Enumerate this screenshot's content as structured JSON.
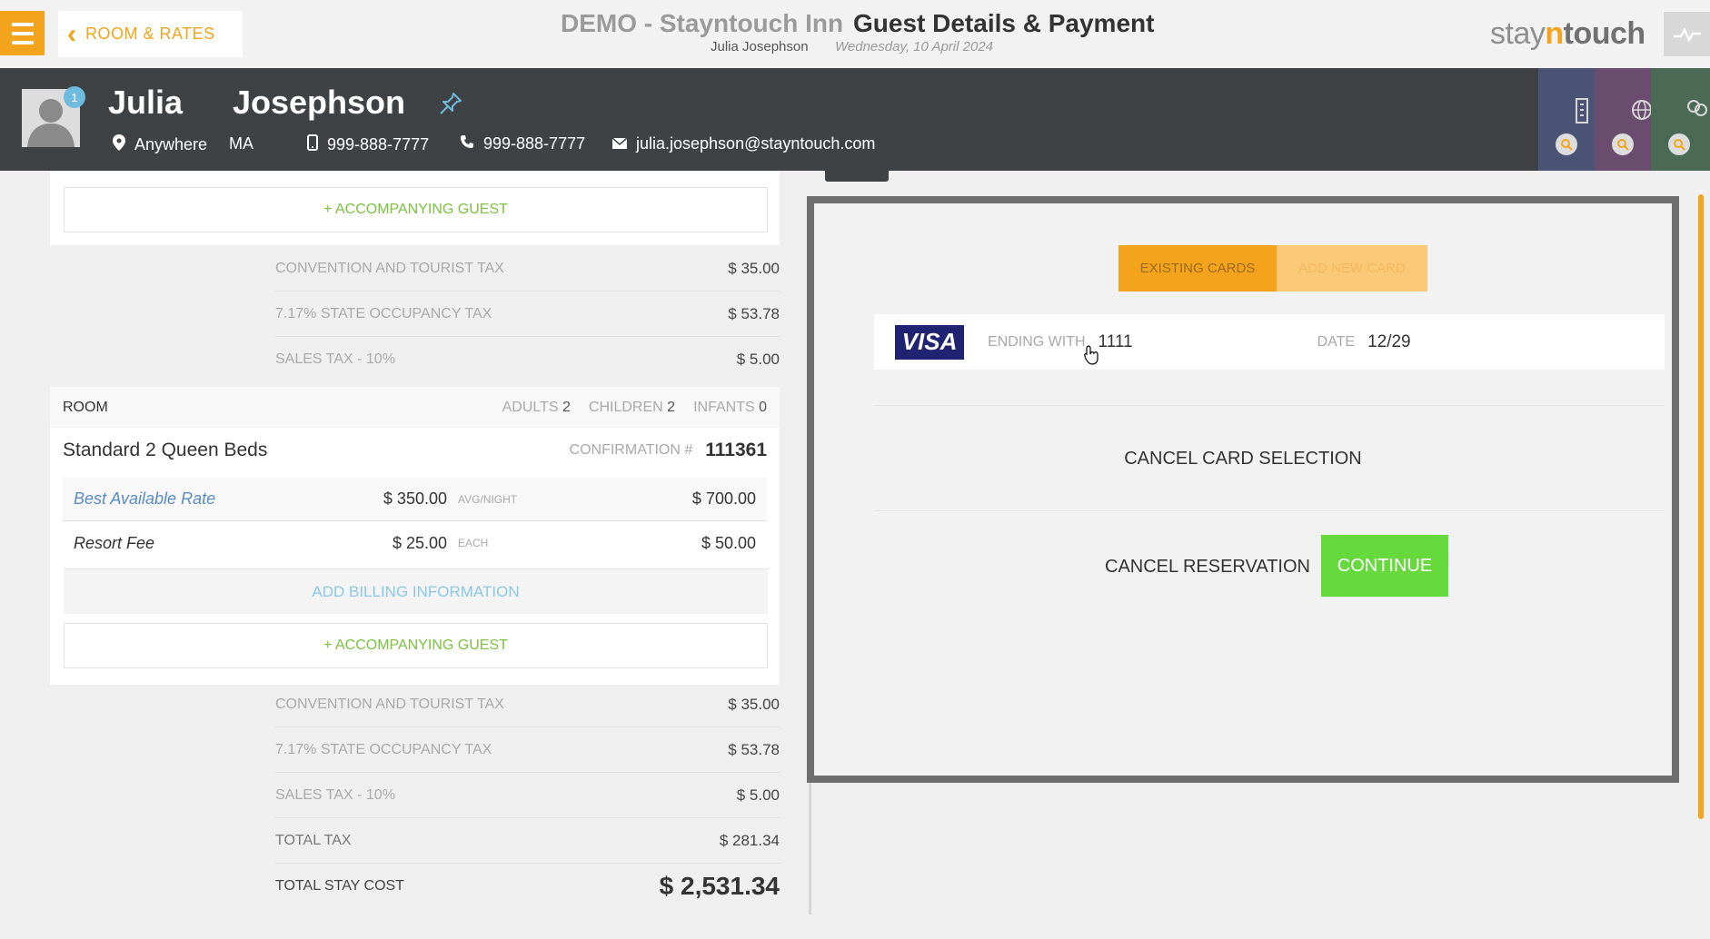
{
  "header": {
    "back_label": "ROOM & RATES",
    "hotel_title": "DEMO - Stayntouch Inn",
    "page_title": "Guest Details & Payment",
    "guest_name": "Julia Josephson",
    "date": "Wednesday, 10 April 2024",
    "brand": {
      "pre": "stay",
      "mid": "n",
      "post": "touch"
    }
  },
  "guest": {
    "first_name": "Julia",
    "last_name": "Josephson",
    "badge_count": "1",
    "city": "Anywhere",
    "state": "MA",
    "mobile": "999-888-7777",
    "phone": "999-888-7777",
    "email": "julia.josephson@stayntouch.com"
  },
  "left": {
    "accompanying_guest": "+ ACCOMPANYING GUEST",
    "taxes_top": [
      {
        "name": "CONVENTION AND TOURIST TAX",
        "value": "$ 35.00"
      },
      {
        "name": "7.17% STATE OCCUPANCY TAX",
        "value": "$ 53.78"
      },
      {
        "name": "SALES TAX - 10%",
        "value": "$ 5.00"
      }
    ],
    "room": {
      "label": "ROOM",
      "adults_label": "ADULTS",
      "adults": "2",
      "children_label": "CHILDREN",
      "children": "2",
      "infants_label": "INFANTS",
      "infants": "0",
      "type": "Standard 2 Queen Beds",
      "confirmation_label": "CONFIRMATION #",
      "confirmation": "111361",
      "rates": [
        {
          "name": "Best Available Rate",
          "unit_price": "$ 350.00",
          "unit": "AVG/NIGHT",
          "total": "$ 700.00"
        },
        {
          "name": "Resort Fee",
          "unit_price": "$ 25.00",
          "unit": "EACH",
          "total": "$ 50.00"
        }
      ],
      "add_billing": "ADD BILLING INFORMATION"
    },
    "taxes_bottom": [
      {
        "name": "CONVENTION AND TOURIST TAX",
        "value": "$ 35.00"
      },
      {
        "name": "7.17% STATE OCCUPANCY TAX",
        "value": "$ 53.78"
      },
      {
        "name": "SALES TAX - 10%",
        "value": "$ 5.00"
      },
      {
        "name": "TOTAL TAX",
        "value": "$ 281.34"
      }
    ],
    "total_stay_label": "TOTAL STAY COST",
    "total_stay_value": "$ 2,531.34"
  },
  "payment": {
    "tabs": [
      "EXISTING CARDS",
      "ADD NEW CARD"
    ],
    "card": {
      "brand": "VISA",
      "ending_label": "ENDING WITH",
      "ending": "1111",
      "date_label": "DATE",
      "date": "12/29"
    },
    "cancel_selection": "CANCEL CARD SELECTION",
    "cancel_reservation": "CANCEL RESERVATION",
    "continue": "CONTINUE"
  },
  "colors": {
    "accent": "#f4a41c",
    "guest_bar": "#3f4245",
    "continue": "#66d93d",
    "accompanying": "#7dc242",
    "stripe_1": "#4b5474",
    "stripe_2": "#6a4d6e",
    "stripe_3": "#4b6a56"
  }
}
